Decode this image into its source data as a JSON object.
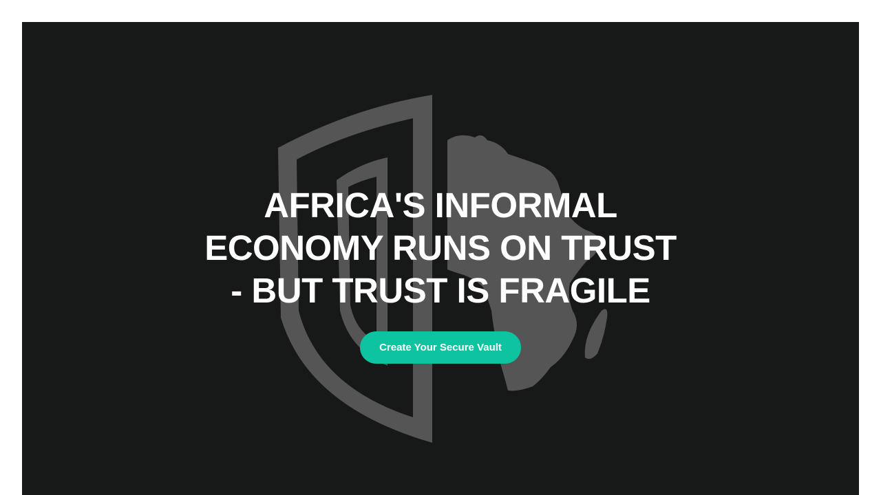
{
  "hero": {
    "headline": "AFRICA'S INFORMAL ECONOMY RUNS ON TRUST - BUT TRUST IS FRAGILE",
    "cta_label": "Create Your Secure Vault",
    "background_color": "#171818",
    "accent_color": "#0dc3a0",
    "logo_icon": "shield-africa-icon"
  }
}
